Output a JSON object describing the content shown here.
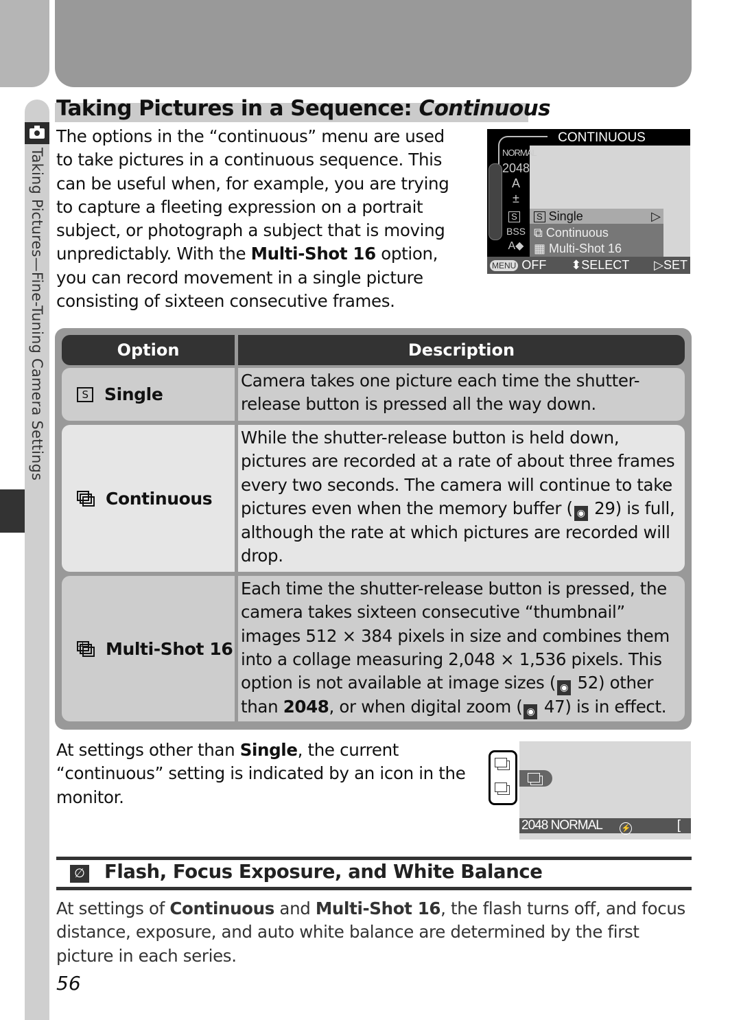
{
  "sidebar": {
    "section_label": "Taking Pictures—Fine-Tuning Camera Settings",
    "icon": "camera-icon"
  },
  "title": {
    "main": "Taking Pictures in a Sequence: ",
    "italic": "Continuous"
  },
  "intro": {
    "before_bold": "The options in the “continuous” menu are used to take pictures in a continuous sequence.  This can be useful when, for example, you are trying to capture a fleeting expression on a portrait subject, or photograph a subject that is moving unpredictably.  With the ",
    "bold": "Multi-Shot 16",
    "after_bold": " option, you can record movement in a single picture consisting of sixteen consecutive frames."
  },
  "camera_menu": {
    "title": "CONTINUOUS",
    "left_column": [
      "NORMAL",
      "2048",
      "A",
      "±",
      "S",
      "BSS",
      "A◆"
    ],
    "options": [
      {
        "label": "Single",
        "icon": "single-frame-icon",
        "selected": true
      },
      {
        "label": "Continuous",
        "icon": "continuous-icon",
        "selected": false
      },
      {
        "label": "Multi-Shot 16",
        "icon": "multi-shot-icon",
        "selected": false
      }
    ],
    "footer": {
      "menu_key": "MENU",
      "off": "OFF",
      "select": "⬍SELECT",
      "set": "▷SET"
    }
  },
  "table": {
    "headers": [
      "Option",
      "Description"
    ],
    "rows": [
      {
        "option": "Single",
        "icon": "single-frame-icon",
        "description": "Camera takes one picture each time the shutter-release button is pressed all the way down."
      },
      {
        "option": "Continuous",
        "icon": "continuous-icon",
        "description_parts": [
          "While the shutter-release button is held down, pictures are recorded at a rate of about three frames every two seconds.  The camera will continue to take pictures even when the memory buffer (",
          "29",
          ") is full, although the rate at which pictures are recorded will drop."
        ]
      },
      {
        "option": "Multi-Shot 16",
        "icon": "multi-shot-icon",
        "description_parts": [
          "Each time the shutter-release button is pressed, the camera takes sixteen consecutive “thumbnail” images 512 × 384 pixels in size and combines them into a collage measuring 2,048 × 1,536 pixels.  This option is not available at image sizes (",
          "52",
          ") other than ",
          "2048",
          ", or when digital zoom  (",
          "47",
          ") is in effect."
        ]
      }
    ]
  },
  "monitor_note": {
    "before_bold": "At settings other than ",
    "bold": "Single",
    "after_bold": ", the current “continuous” setting is indicated by an icon in the monitor."
  },
  "monitor": {
    "status_size": "2048",
    "status_quality": "NORMAL",
    "flash_icon": "flash-off-icon",
    "bracket": "["
  },
  "note": {
    "icon": "pencil-note-icon",
    "title": "Flash, Focus Exposure, and White Balance",
    "text_parts": [
      "At settings of ",
      "Continuous",
      " and ",
      "Multi-Shot 16",
      ", the flash turns off, and focus distance, exposure, and auto white balance are determined by the first picture in each series."
    ]
  },
  "page_number": "56"
}
